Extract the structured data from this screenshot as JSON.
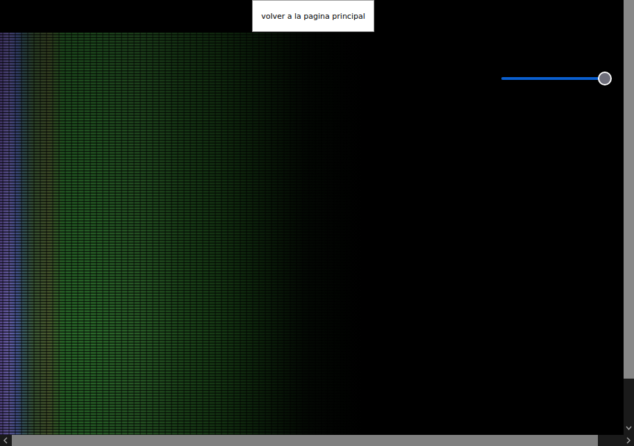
{
  "button": {
    "label": "volver a la pagina principal"
  },
  "slider": {
    "level": 1.0
  }
}
